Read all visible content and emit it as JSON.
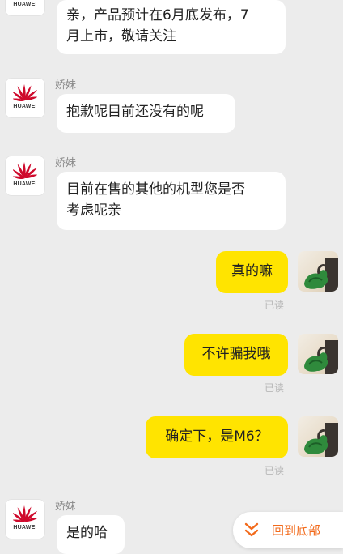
{
  "messages": [
    {
      "sender": "",
      "text": "亲，产品预计在6月底发布，7\n月上市，敬请关注"
    },
    {
      "sender": "娇妹",
      "text": "抱歉呢目前还没有的呢"
    },
    {
      "sender": "娇妹",
      "text": "目前在售的其他的机型您是否\n考虑呢亲"
    },
    {
      "text": "真的嘛",
      "status": "已读"
    },
    {
      "text": "不许骗我哦",
      "status": "已读"
    },
    {
      "text": "确定下，是M6？",
      "status": "已读"
    },
    {
      "sender": "娇妹",
      "text": "是的哈"
    }
  ],
  "brand_name": "HUAWEI",
  "back_to_bottom": {
    "label": "回到底部",
    "icon": "double-chevron-down-icon"
  },
  "colors": {
    "accent": "#f26a1b",
    "bubble_self": "#ffe400",
    "brand_red": "#cf0a2c"
  }
}
